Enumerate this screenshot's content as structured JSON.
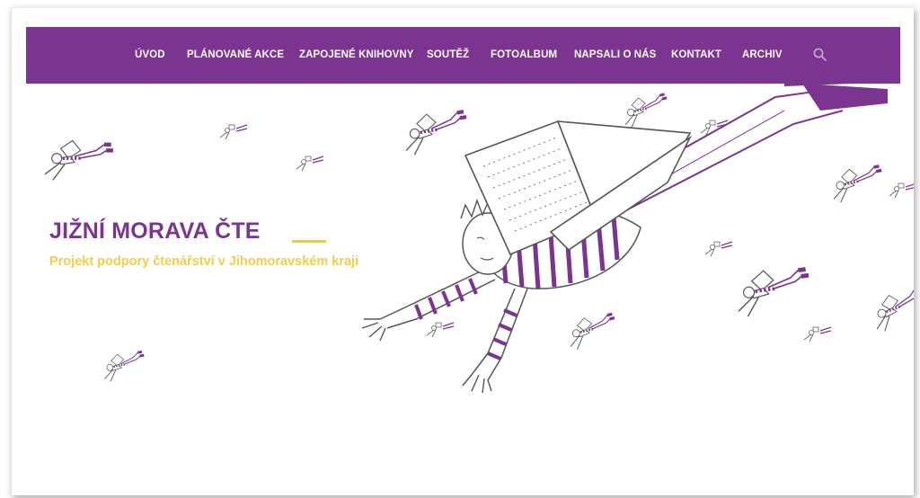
{
  "nav": {
    "items": [
      {
        "label": "ÚVOD"
      },
      {
        "label": "PLÁNOVANÉ AKCE"
      },
      {
        "label": "ZAPOJENÉ KNIHOVNY"
      },
      {
        "label": "SOUTĚŽ"
      },
      {
        "label": "FOTOALBUM"
      },
      {
        "label": "NAPSALI O NÁS"
      },
      {
        "label": "KONTAKT"
      },
      {
        "label": "ARCHIV"
      }
    ],
    "search_icon": "search-icon"
  },
  "hero": {
    "title": "JIŽNÍ MORAVA ČTE",
    "subtitle": "Projekt podpory čtenářství v Jihomoravském kraji",
    "illustration": "flying-children-reading-books"
  },
  "colors": {
    "brand_purple": "#7b3591",
    "accent_yellow": "#f2cd48",
    "nav_text": "#ffffff"
  }
}
